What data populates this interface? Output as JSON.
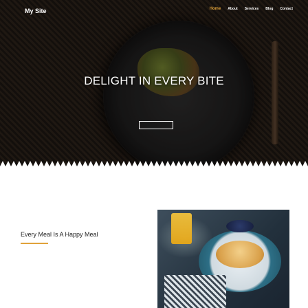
{
  "header": {
    "site_title": "My Site",
    "nav": [
      {
        "label": "Home",
        "active": true
      },
      {
        "label": "About",
        "active": false
      },
      {
        "label": "Services",
        "active": false
      },
      {
        "label": "Blog",
        "active": false
      },
      {
        "label": "Contact",
        "active": false
      }
    ]
  },
  "hero": {
    "title": "DELIGHT IN EVERY BITE",
    "text": "",
    "button_label": ""
  },
  "about": {
    "title": "Every Meal Is A Happy Meal",
    "paragraphs": [
      "",
      ""
    ]
  },
  "colors": {
    "accent": "#e0a23a",
    "hero_bg": "#161210",
    "text_muted": "#9a9a9a"
  }
}
